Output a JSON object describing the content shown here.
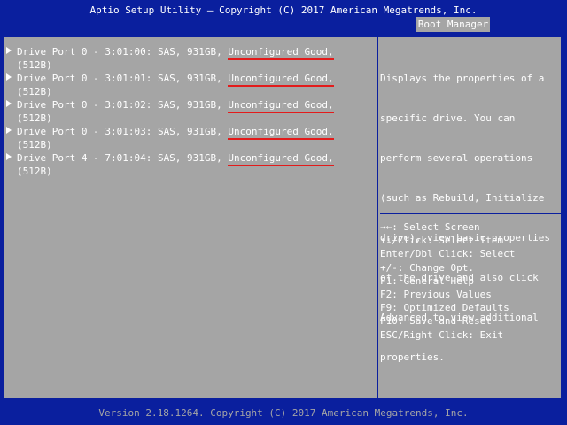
{
  "header": {
    "title": "Aptio Setup Utility – Copyright (C) 2017 American Megatrends, Inc.",
    "active_tab": "Boot Manager"
  },
  "drives": [
    {
      "line1_prefix": "Drive Port 0 - 3:01:00: SAS, 931GB, ",
      "status": "Unconfigured Good,",
      "line2": "(512B)"
    },
    {
      "line1_prefix": "Drive Port 0 - 3:01:01: SAS, 931GB, ",
      "status": "Unconfigured Good,",
      "line2": "(512B)"
    },
    {
      "line1_prefix": "Drive Port 0 - 3:01:02: SAS, 931GB, ",
      "status": "Unconfigured Good,",
      "line2": "(512B)"
    },
    {
      "line1_prefix": "Drive Port 0 - 3:01:03: SAS, 931GB, ",
      "status": "Unconfigured Good,",
      "line2": "(512B)"
    },
    {
      "line1_prefix": "Drive Port 4 - 7:01:04: SAS, 931GB, ",
      "status": "Unconfigured Good,",
      "line2": "(512B)"
    }
  ],
  "help": {
    "lines": [
      "Displays the properties of a",
      "specific drive. You can",
      "perform several operations",
      "(such as Rebuild, Initialize",
      "drive), view basic properties",
      "of the drive and also click",
      "Advanced to view additional",
      "properties."
    ]
  },
  "keys": [
    "→←: Select Screen",
    "↑↓/Click: Select Item",
    "Enter/Dbl Click: Select",
    "+/-: Change Opt.",
    "F1: General Help",
    "F2: Previous Values",
    "F9: Optimized Defaults",
    "F10: Save and Reset",
    "ESC/Right Click: Exit"
  ],
  "footer": {
    "text": "Version 2.18.1264. Copyright (C) 2017 American Megatrends, Inc."
  },
  "colors": {
    "background_blue": "#0a1f9e",
    "panel_gray": "#a5a5a5",
    "text_white": "#ffffff",
    "status_underline_red": "#e31b1b"
  }
}
